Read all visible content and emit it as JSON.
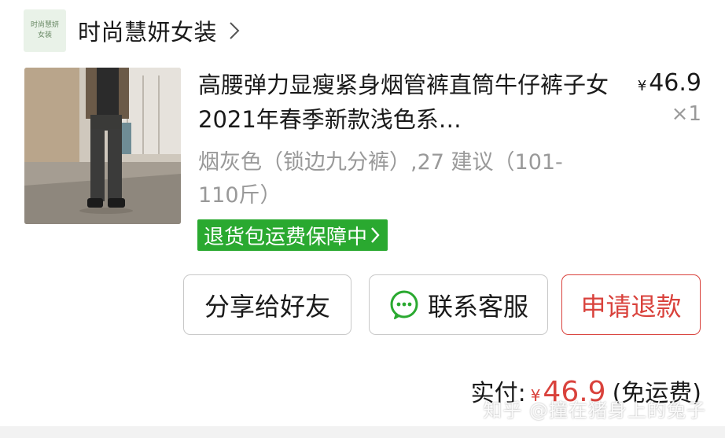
{
  "store": {
    "logo_line1": "时尚慧妍",
    "logo_line2": "女装",
    "name": "时尚慧妍女装"
  },
  "product": {
    "title": "高腰弹力显瘦紧身烟管裤直筒牛仔裤子女2021年春季新款浅色系…",
    "price_symbol": "¥",
    "price": "46.9",
    "quantity": "×1",
    "sku": "烟灰色（锁边九分裤）,27 建议（101-110斤）"
  },
  "badge": {
    "label": "退货包运费保障中"
  },
  "actions": {
    "share": "分享给好友",
    "service": "联系客服",
    "refund": "申请退款"
  },
  "payment": {
    "label": "实付:",
    "symbol": "¥",
    "amount": "46.9",
    "note": "(免运费)"
  },
  "watermark": "知乎 @撞在猪身上的兔子",
  "colors": {
    "accent_red": "#d9423c",
    "badge_green": "#2aa930",
    "wechat_green": "#2aa930"
  },
  "icons": [
    "chevron-right-icon",
    "wechat-chat-icon"
  ]
}
